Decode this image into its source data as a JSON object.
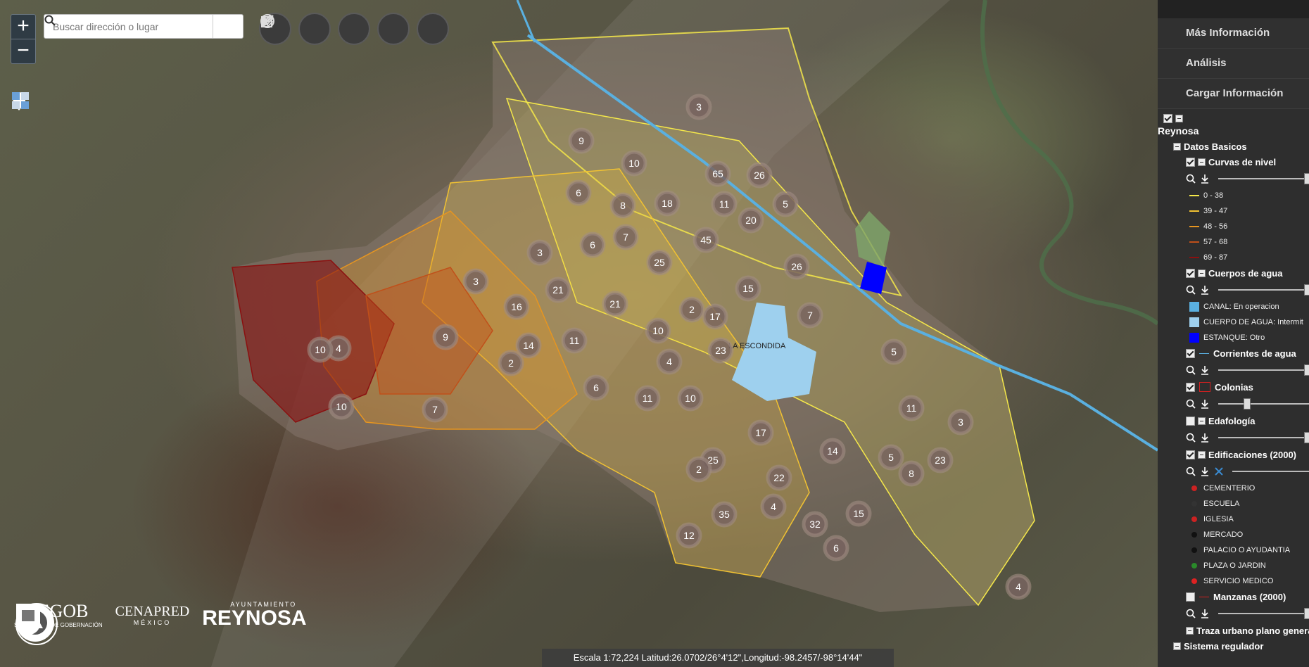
{
  "map": {
    "search_placeholder": "Buscar dirección o lugar",
    "zoom_in": "+",
    "zoom_out": "−",
    "place_label": "LA ESCONDIDA",
    "scale_text": "Escala 1:72,224 Latitud:26.0702/26°4'12\",Longitud:-98.2457/-98°14'44\"",
    "clusters": [
      {
        "v": "3"
      },
      {
        "v": "9"
      },
      {
        "v": "10"
      },
      {
        "v": "65"
      },
      {
        "v": "26"
      },
      {
        "v": "6"
      },
      {
        "v": "8"
      },
      {
        "v": "18"
      },
      {
        "v": "11"
      },
      {
        "v": "5"
      },
      {
        "v": "20"
      },
      {
        "v": "6"
      },
      {
        "v": "7"
      },
      {
        "v": "45"
      },
      {
        "v": "3"
      },
      {
        "v": "25"
      },
      {
        "v": "26"
      },
      {
        "v": "3"
      },
      {
        "v": "21"
      },
      {
        "v": "16"
      },
      {
        "v": "21"
      },
      {
        "v": "15"
      },
      {
        "v": "2"
      },
      {
        "v": "17"
      },
      {
        "v": "7"
      },
      {
        "v": "10"
      },
      {
        "v": "9"
      },
      {
        "v": "14"
      },
      {
        "v": "11"
      },
      {
        "v": "4"
      },
      {
        "v": "23"
      },
      {
        "v": "10"
      },
      {
        "v": "5"
      },
      {
        "v": "2"
      },
      {
        "v": "4"
      },
      {
        "v": "6"
      },
      {
        "v": "11"
      },
      {
        "v": "10"
      },
      {
        "v": "10"
      },
      {
        "v": "7"
      },
      {
        "v": "11"
      },
      {
        "v": "3"
      },
      {
        "v": "17"
      },
      {
        "v": "14"
      },
      {
        "v": "5"
      },
      {
        "v": "23"
      },
      {
        "v": "25"
      },
      {
        "v": "2"
      },
      {
        "v": "8"
      },
      {
        "v": "22"
      },
      {
        "v": "35"
      },
      {
        "v": "4"
      },
      {
        "v": "15"
      },
      {
        "v": "32"
      },
      {
        "v": "12"
      },
      {
        "v": "6"
      },
      {
        "v": "4"
      }
    ]
  },
  "logos": {
    "segob": "SEGOB",
    "segob_sub": "SECRETARÍA DE GOBERNACIÓN",
    "cenapred": "CENAPRED",
    "cenapred_sub": "MÉXICO",
    "ayuntamiento": "AYUNTAMIENTO",
    "reynosa": "REYNOSA"
  },
  "panel": {
    "menu": [
      "Más Información",
      "Análisis",
      "Cargar Información"
    ],
    "root": "Reynosa",
    "group": "Datos Basicos",
    "curvas": {
      "title": "Curvas de nivel",
      "legend": [
        {
          "label": "0 - 38",
          "color": "#f5e84a"
        },
        {
          "label": "39 - 47",
          "color": "#f1c232"
        },
        {
          "label": "48 - 56",
          "color": "#e69520"
        },
        {
          "label": "57 - 68",
          "color": "#c0501a"
        },
        {
          "label": "69 - 87",
          "color": "#8b1010"
        }
      ]
    },
    "cuerpos": {
      "title": "Cuerpos de agua",
      "legend": [
        {
          "label": "CANAL: En operacion",
          "color": "#5ab0e0"
        },
        {
          "label": "CUERPO DE AGUA: Intermit",
          "color": "#9ed0ee"
        },
        {
          "label": "ESTANQUE: Otro",
          "color": "#0000ff"
        }
      ]
    },
    "corrientes": {
      "title": "Corrientes de agua"
    },
    "colonias": {
      "title": "Colonias"
    },
    "edafologia": {
      "title": "Edafología"
    },
    "edificaciones": {
      "title": "Edificaciones (2000)",
      "legend": [
        {
          "label": "CEMENTERIO",
          "color": "#cc2222"
        },
        {
          "label": "ESCUELA",
          "color": "#333333"
        },
        {
          "label": "IGLESIA",
          "color": "#cc2222"
        },
        {
          "label": "MERCADO",
          "color": "#111111"
        },
        {
          "label": "PALACIO O AYUDANTIA",
          "color": "#111111"
        },
        {
          "label": "PLAZA O JARDIN",
          "color": "#2a8a2a"
        },
        {
          "label": "SERVICIO MEDICO",
          "color": "#dd2222"
        }
      ]
    },
    "manzanas": {
      "title": "Manzanas (2000)"
    },
    "traza": {
      "title": "Traza urbano plano general"
    },
    "sistema": {
      "title": "Sistema regulador"
    }
  }
}
